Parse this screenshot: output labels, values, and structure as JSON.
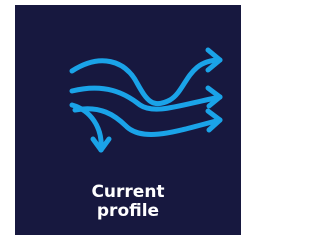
{
  "tile": {
    "label_lines": [
      "Current",
      "profile"
    ],
    "icon": "current-flow-arrows-icon",
    "background_color": "#17183f",
    "accent_color": "#1aa3e8",
    "text_color": "#ffffff"
  }
}
